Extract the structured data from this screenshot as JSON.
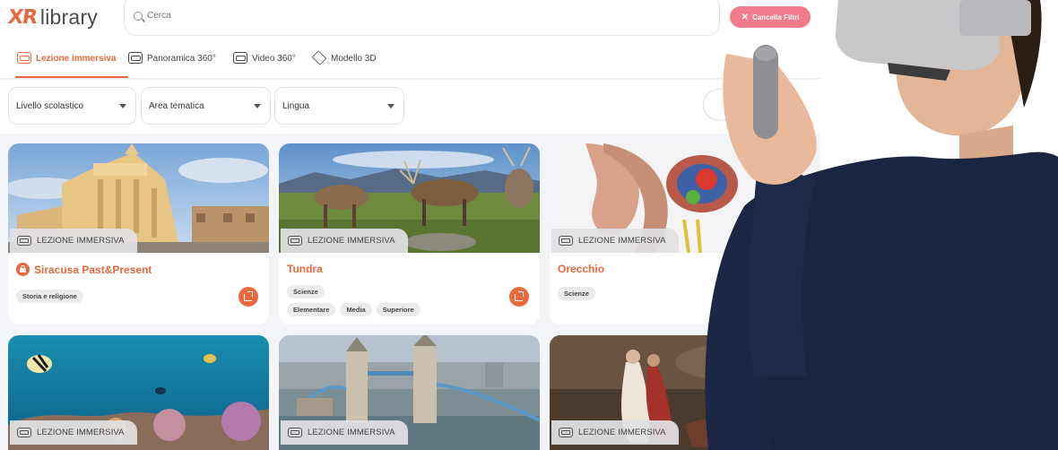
{
  "app": {
    "logo": {
      "mark": "XR",
      "word": "library"
    },
    "search": {
      "placeholder": "Cerca",
      "value": ""
    },
    "clear_filters_label": "Cancella Filtri",
    "tabs": [
      {
        "label": "Lezione immersiva",
        "icon": "headset-icon",
        "active": true
      },
      {
        "label": "Panoramica 360°",
        "icon": "panorama-icon",
        "active": false
      },
      {
        "label": "Video 360°",
        "icon": "video360-icon",
        "active": false
      },
      {
        "label": "Modello 3D",
        "icon": "cube-icon",
        "active": false
      }
    ],
    "filters": [
      {
        "label": "Livello scolastico"
      },
      {
        "label": "Area tematica"
      },
      {
        "label": "Lingua"
      }
    ],
    "badge_label": "LEZIONE IMMERSIVA",
    "cards": [
      {
        "title": "Siracusa Past&Present",
        "locked": true,
        "tags": [
          "Storia e religione"
        ],
        "levels": []
      },
      {
        "title": "Tundra",
        "locked": false,
        "tags": [
          "Scienze"
        ],
        "levels": [
          "Elementare",
          "Media",
          "Superiore"
        ]
      },
      {
        "title": "Orecchio",
        "locked": false,
        "tags": [
          "Scienze"
        ],
        "levels": []
      },
      {
        "title": "",
        "locked": false,
        "tags": [],
        "levels": []
      },
      {
        "title": "",
        "locked": false,
        "tags": [],
        "levels": []
      },
      {
        "title": "",
        "locked": false,
        "tags": [],
        "levels": []
      }
    ]
  },
  "colors": {
    "accent": "#e9683d",
    "clear_button": "#f17b8a",
    "page_bg": "#f3f4f7",
    "headset": "#c8c8cb",
    "sweater": "#1b2440"
  }
}
